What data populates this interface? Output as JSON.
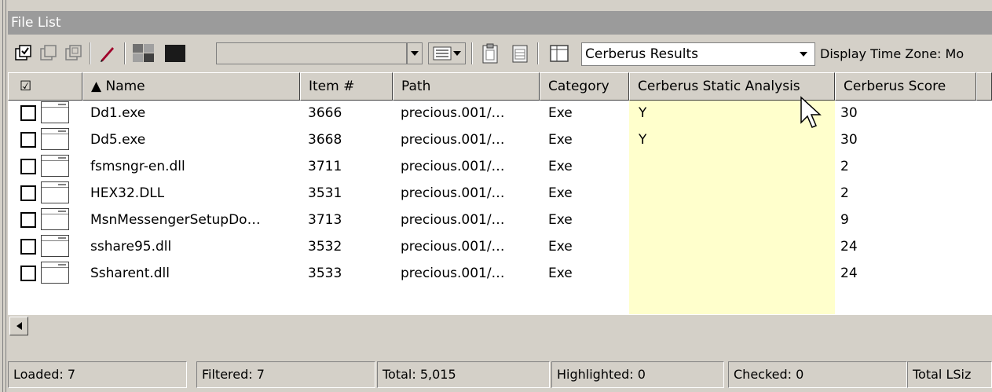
{
  "panel": {
    "title": "File List"
  },
  "toolbar": {
    "view_select_value": "Cerberus Results",
    "time_zone_label": "Display Time Zone: Mo",
    "icons": [
      "check-all-icon",
      "uncheck-all-icon",
      "invert-check-icon",
      "edit-pencil-icon",
      "color-squares-icon",
      "clipboard-icon",
      "report-icon",
      "table-view-icon",
      "chevron-down-icon"
    ]
  },
  "columns": {
    "checkbox": "☑",
    "name": "▲  Name",
    "item": "Item #",
    "path": "Path",
    "category": "Category",
    "static": "Cerberus Static Analysis",
    "score": "Cerberus Score"
  },
  "rows": [
    {
      "name": "Dd1.exe",
      "item": "3666",
      "path": "precious.001/…",
      "category": "Exe",
      "static": "Y",
      "score": "30"
    },
    {
      "name": "Dd5.exe",
      "item": "3668",
      "path": "precious.001/…",
      "category": "Exe",
      "static": "Y",
      "score": "30"
    },
    {
      "name": "fsmsngr-en.dll",
      "item": "3711",
      "path": "precious.001/…",
      "category": "Exe",
      "static": "",
      "score": "2"
    },
    {
      "name": "HEX32.DLL",
      "item": "3531",
      "path": "precious.001/…",
      "category": "Exe",
      "static": "",
      "score": "2"
    },
    {
      "name": "MsnMessengerSetupDo…",
      "item": "3713",
      "path": "precious.001/…",
      "category": "Exe",
      "static": "",
      "score": "9"
    },
    {
      "name": "sshare95.dll",
      "item": "3532",
      "path": "precious.001/…",
      "category": "Exe",
      "static": "",
      "score": "24"
    },
    {
      "name": "Ssharent.dll",
      "item": "3533",
      "path": "precious.001/…",
      "category": "Exe",
      "static": "",
      "score": "24"
    }
  ],
  "status": {
    "loaded": "Loaded: 7",
    "filtered": "Filtered: 7",
    "total": "Total: 5,015",
    "highlighted": "Highlighted: 0",
    "checked": "Checked: 0",
    "total_lsize": "Total LSiz"
  },
  "colors": {
    "title_bg": "#9b9b9b",
    "highlight_col": "#ffffcc",
    "chrome": "#d4d0c8"
  }
}
